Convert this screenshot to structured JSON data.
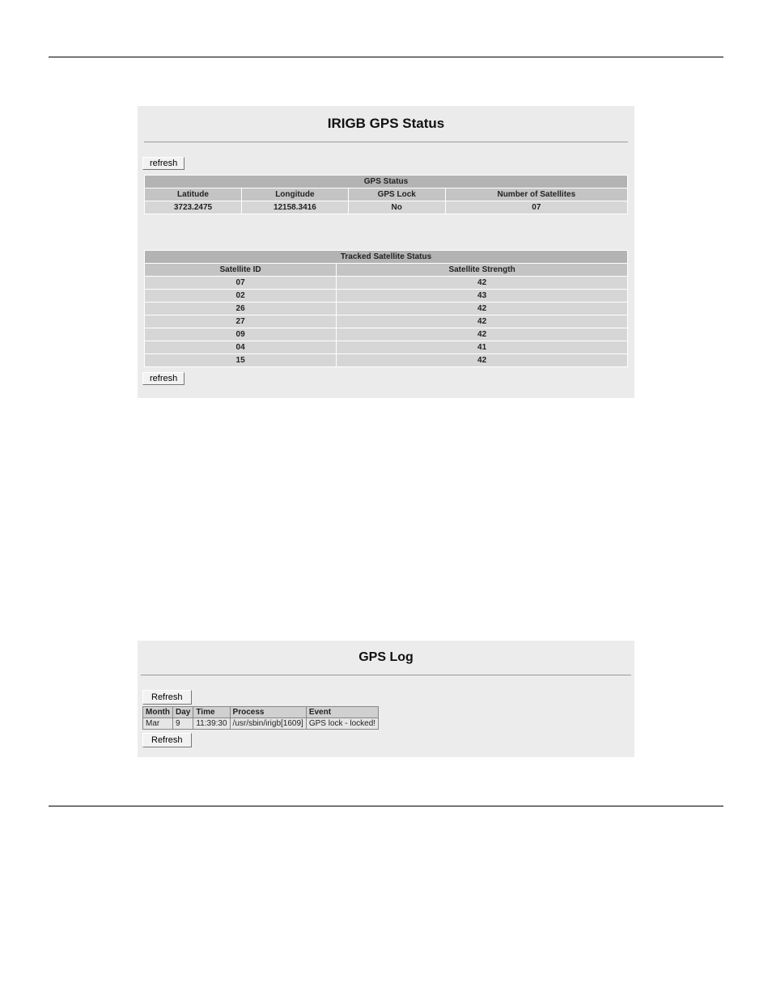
{
  "status_panel": {
    "title": "IRIGB GPS Status",
    "refresh_top": "refresh",
    "refresh_bottom": "refresh",
    "gps_table": {
      "caption": "GPS Status",
      "headers": [
        "Latitude",
        "Longitude",
        "GPS Lock",
        "Number of Satellites"
      ],
      "row": [
        "3723.2475",
        "12158.3416",
        "No",
        "07"
      ]
    },
    "sat_table": {
      "caption": "Tracked Satellite Status",
      "headers": [
        "Satellite ID",
        "Satellite Strength"
      ],
      "rows": [
        [
          "07",
          "42"
        ],
        [
          "02",
          "43"
        ],
        [
          "26",
          "42"
        ],
        [
          "27",
          "42"
        ],
        [
          "09",
          "42"
        ],
        [
          "04",
          "41"
        ],
        [
          "15",
          "42"
        ]
      ]
    }
  },
  "log_panel": {
    "title": "GPS Log",
    "refresh_top": "Refresh",
    "refresh_bottom": "Refresh",
    "headers": [
      "Month",
      "Day",
      "Time",
      "Process",
      "Event"
    ],
    "row": [
      "Mar",
      "9",
      "11:39:30",
      "/usr/sbin/irigb[1609]",
      "GPS lock - locked!"
    ]
  }
}
